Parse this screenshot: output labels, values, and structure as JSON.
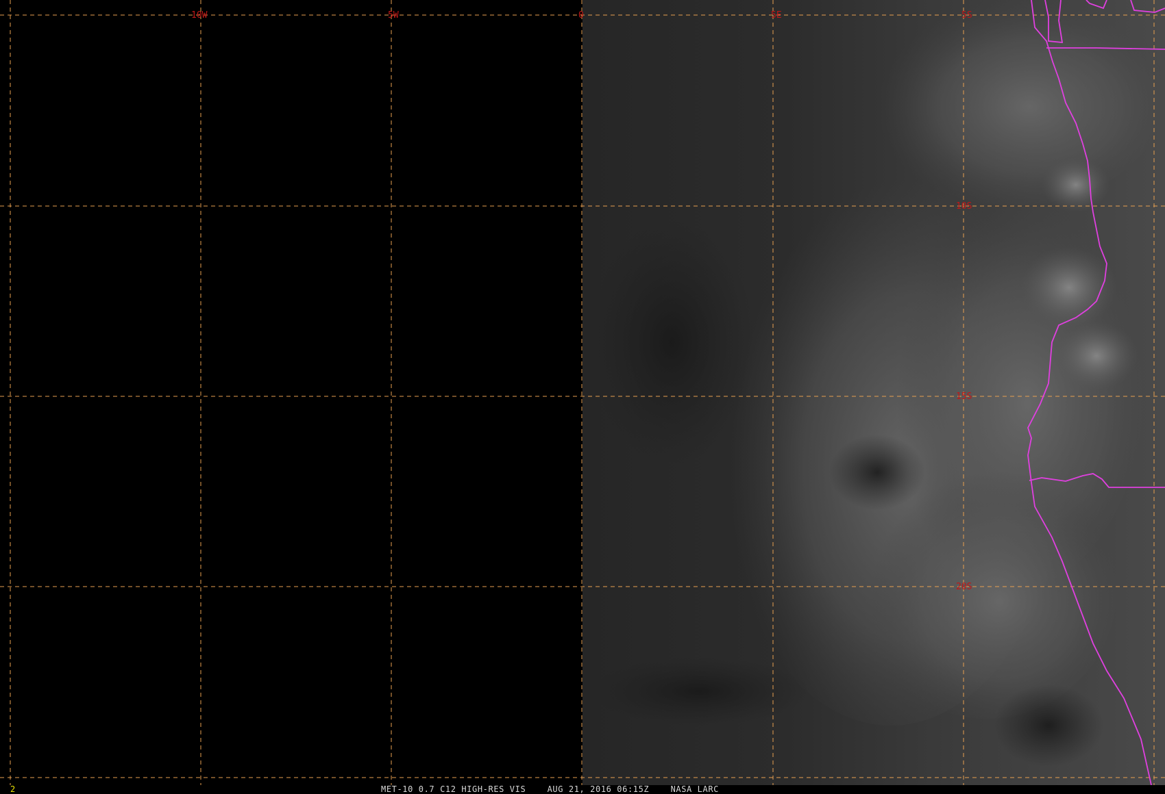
{
  "map": {
    "grid_color": "#e8a050",
    "label_color": "#c01818",
    "boundary_color": "#e040e0",
    "longitude_labels": [
      "10W",
      "5W",
      "0",
      "5E",
      "5S"
    ],
    "latitude_labels": [
      "10S",
      "15S",
      "20S"
    ]
  },
  "status_bar": {
    "frame_number": "2",
    "satellite": "MET-10 0.7 C12 HIGH-RES VIS",
    "datetime": "AUG 21, 2016 06:15Z",
    "source": "NASA LARC"
  }
}
